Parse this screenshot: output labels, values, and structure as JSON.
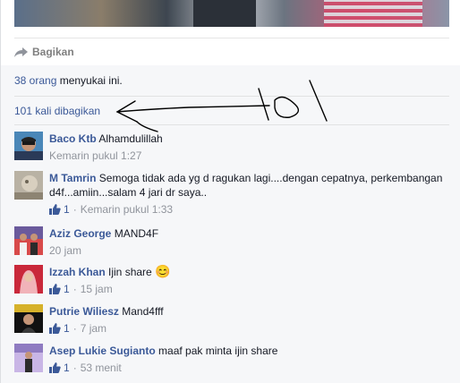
{
  "post": {
    "share_label": "Bagikan",
    "likes_count": "38 orang",
    "likes_suffix": " menyukai ini.",
    "shares_text": "101 kali dibagikan"
  },
  "annotation": {
    "text": "101"
  },
  "comments": [
    {
      "author": "Baco Ktb",
      "text": "Alhamdulillah",
      "likes": "",
      "timestamp": "Kemarin pukul 1:27"
    },
    {
      "author": "M Tamrin",
      "text": "Semoga tidak ada yg d ragukan lagi....dengan cepatnya, perkembangan d4f...amiin...salam 4 jari dr saya..",
      "likes": "1",
      "timestamp": "Kemarin pukul 1:33"
    },
    {
      "author": "Aziz George",
      "text": "MAND4F",
      "likes": "",
      "timestamp": "20 jam"
    },
    {
      "author": "Izzah Khan",
      "text": "Ijin share",
      "emoji": "😊",
      "likes": "1",
      "timestamp": "15 jam"
    },
    {
      "author": "Putrie Wiliesz",
      "text": "Mand4fff",
      "likes": "1",
      "timestamp": "7 jam"
    },
    {
      "author": "Asep Lukie Sugianto",
      "text": "maaf pak minta ijin share",
      "likes": "1",
      "timestamp": "53 menit"
    }
  ],
  "colors": {
    "link": "#3b5998",
    "meta": "#90949c",
    "feedback_bg": "#f6f7f9"
  }
}
